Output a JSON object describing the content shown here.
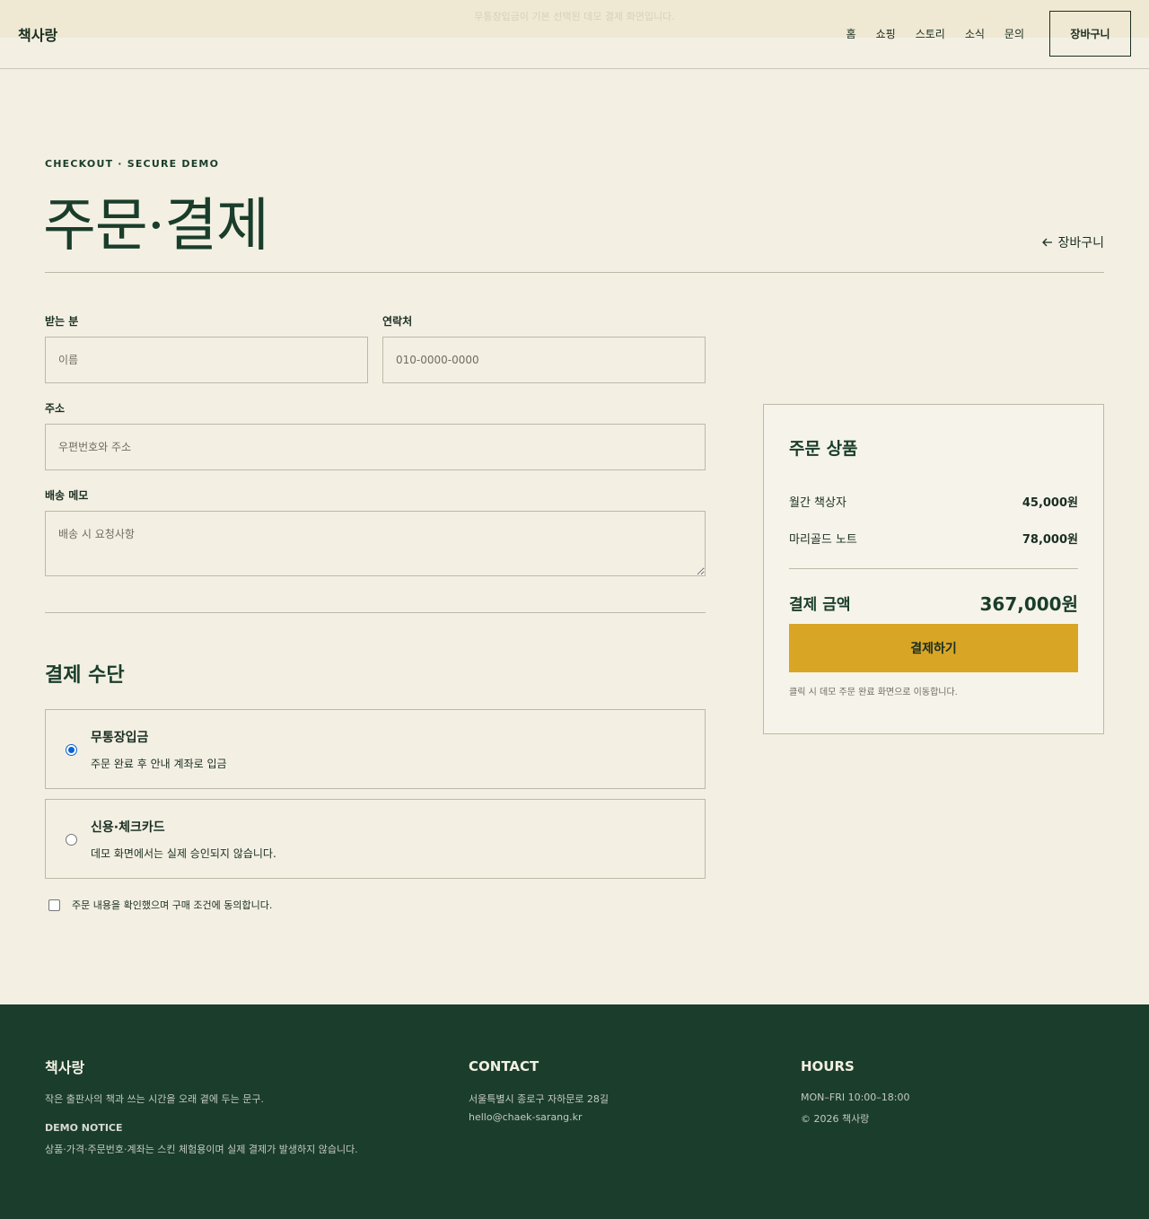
{
  "header": {
    "banner_text": "무통장입금이 기본 선택된 데모 결제 화면입니다.",
    "logo": "책사랑",
    "nav": [
      "홈",
      "쇼핑",
      "스토리",
      "소식",
      "문의"
    ],
    "cart_button": "장바구니"
  },
  "title_area": {
    "eyebrow": "CHECKOUT · SECURE DEMO",
    "title": "주문·결제",
    "back_link": "장바구니",
    "back_icon": "arrow-left-icon"
  },
  "form": {
    "recipient_label": "받는 분",
    "recipient_placeholder": "이름",
    "phone_label": "연락처",
    "phone_placeholder": "010-0000-0000",
    "address_label": "주소",
    "address_placeholder": "우편번호와 주소",
    "memo_label": "배송 메모",
    "memo_placeholder": "배송 시 요청사항"
  },
  "payment": {
    "title": "결제 수단",
    "options": [
      {
        "title": "무통장입금",
        "desc": "주문 완료 후 안내 계좌로 입금",
        "selected": true
      },
      {
        "title": "신용·체크카드",
        "desc": "데모 화면에서는 실제 승인되지 않습니다.",
        "selected": false
      }
    ],
    "agree_text": "주문 내용을 확인했으며 구매 조건에 동의합니다."
  },
  "summary": {
    "title": "주문 상품",
    "items": [
      {
        "name": "월간 책상자",
        "price": "45,000원"
      },
      {
        "name": "마리골드 노트",
        "price": "78,000원"
      }
    ],
    "total_label": "결제 금액",
    "total_value": "367,000원",
    "pay_button": "결제하기",
    "note": "클릭 시 데모 주문 완료 화면으로 이동합니다."
  },
  "footer": {
    "logo": "책사랑",
    "tagline": "작은 출판사의 책과 쓰는 시간을 오래 곁에 두는 문구.",
    "demo_notice_label": "DEMO NOTICE",
    "demo_notice_text": "상품·가격·주문번호·계좌는 스킨 체험용이며 실제 결제가 발생하지 않습니다.",
    "contact_head": "CONTACT",
    "address": "서울특별시 종로구 자하문로 28길",
    "email": "hello@chaek-sarang.kr",
    "hours_head": "HOURS",
    "hours": "MON–FRI 10:00–18:00",
    "copyright": "© 2026 책사랑"
  },
  "colors": {
    "background": "#f3f0e3",
    "primary_green": "#1a3d2b",
    "footer_green": "#1b3d2c",
    "accent_gold": "#d9a524",
    "border": "#bdb9a8"
  }
}
